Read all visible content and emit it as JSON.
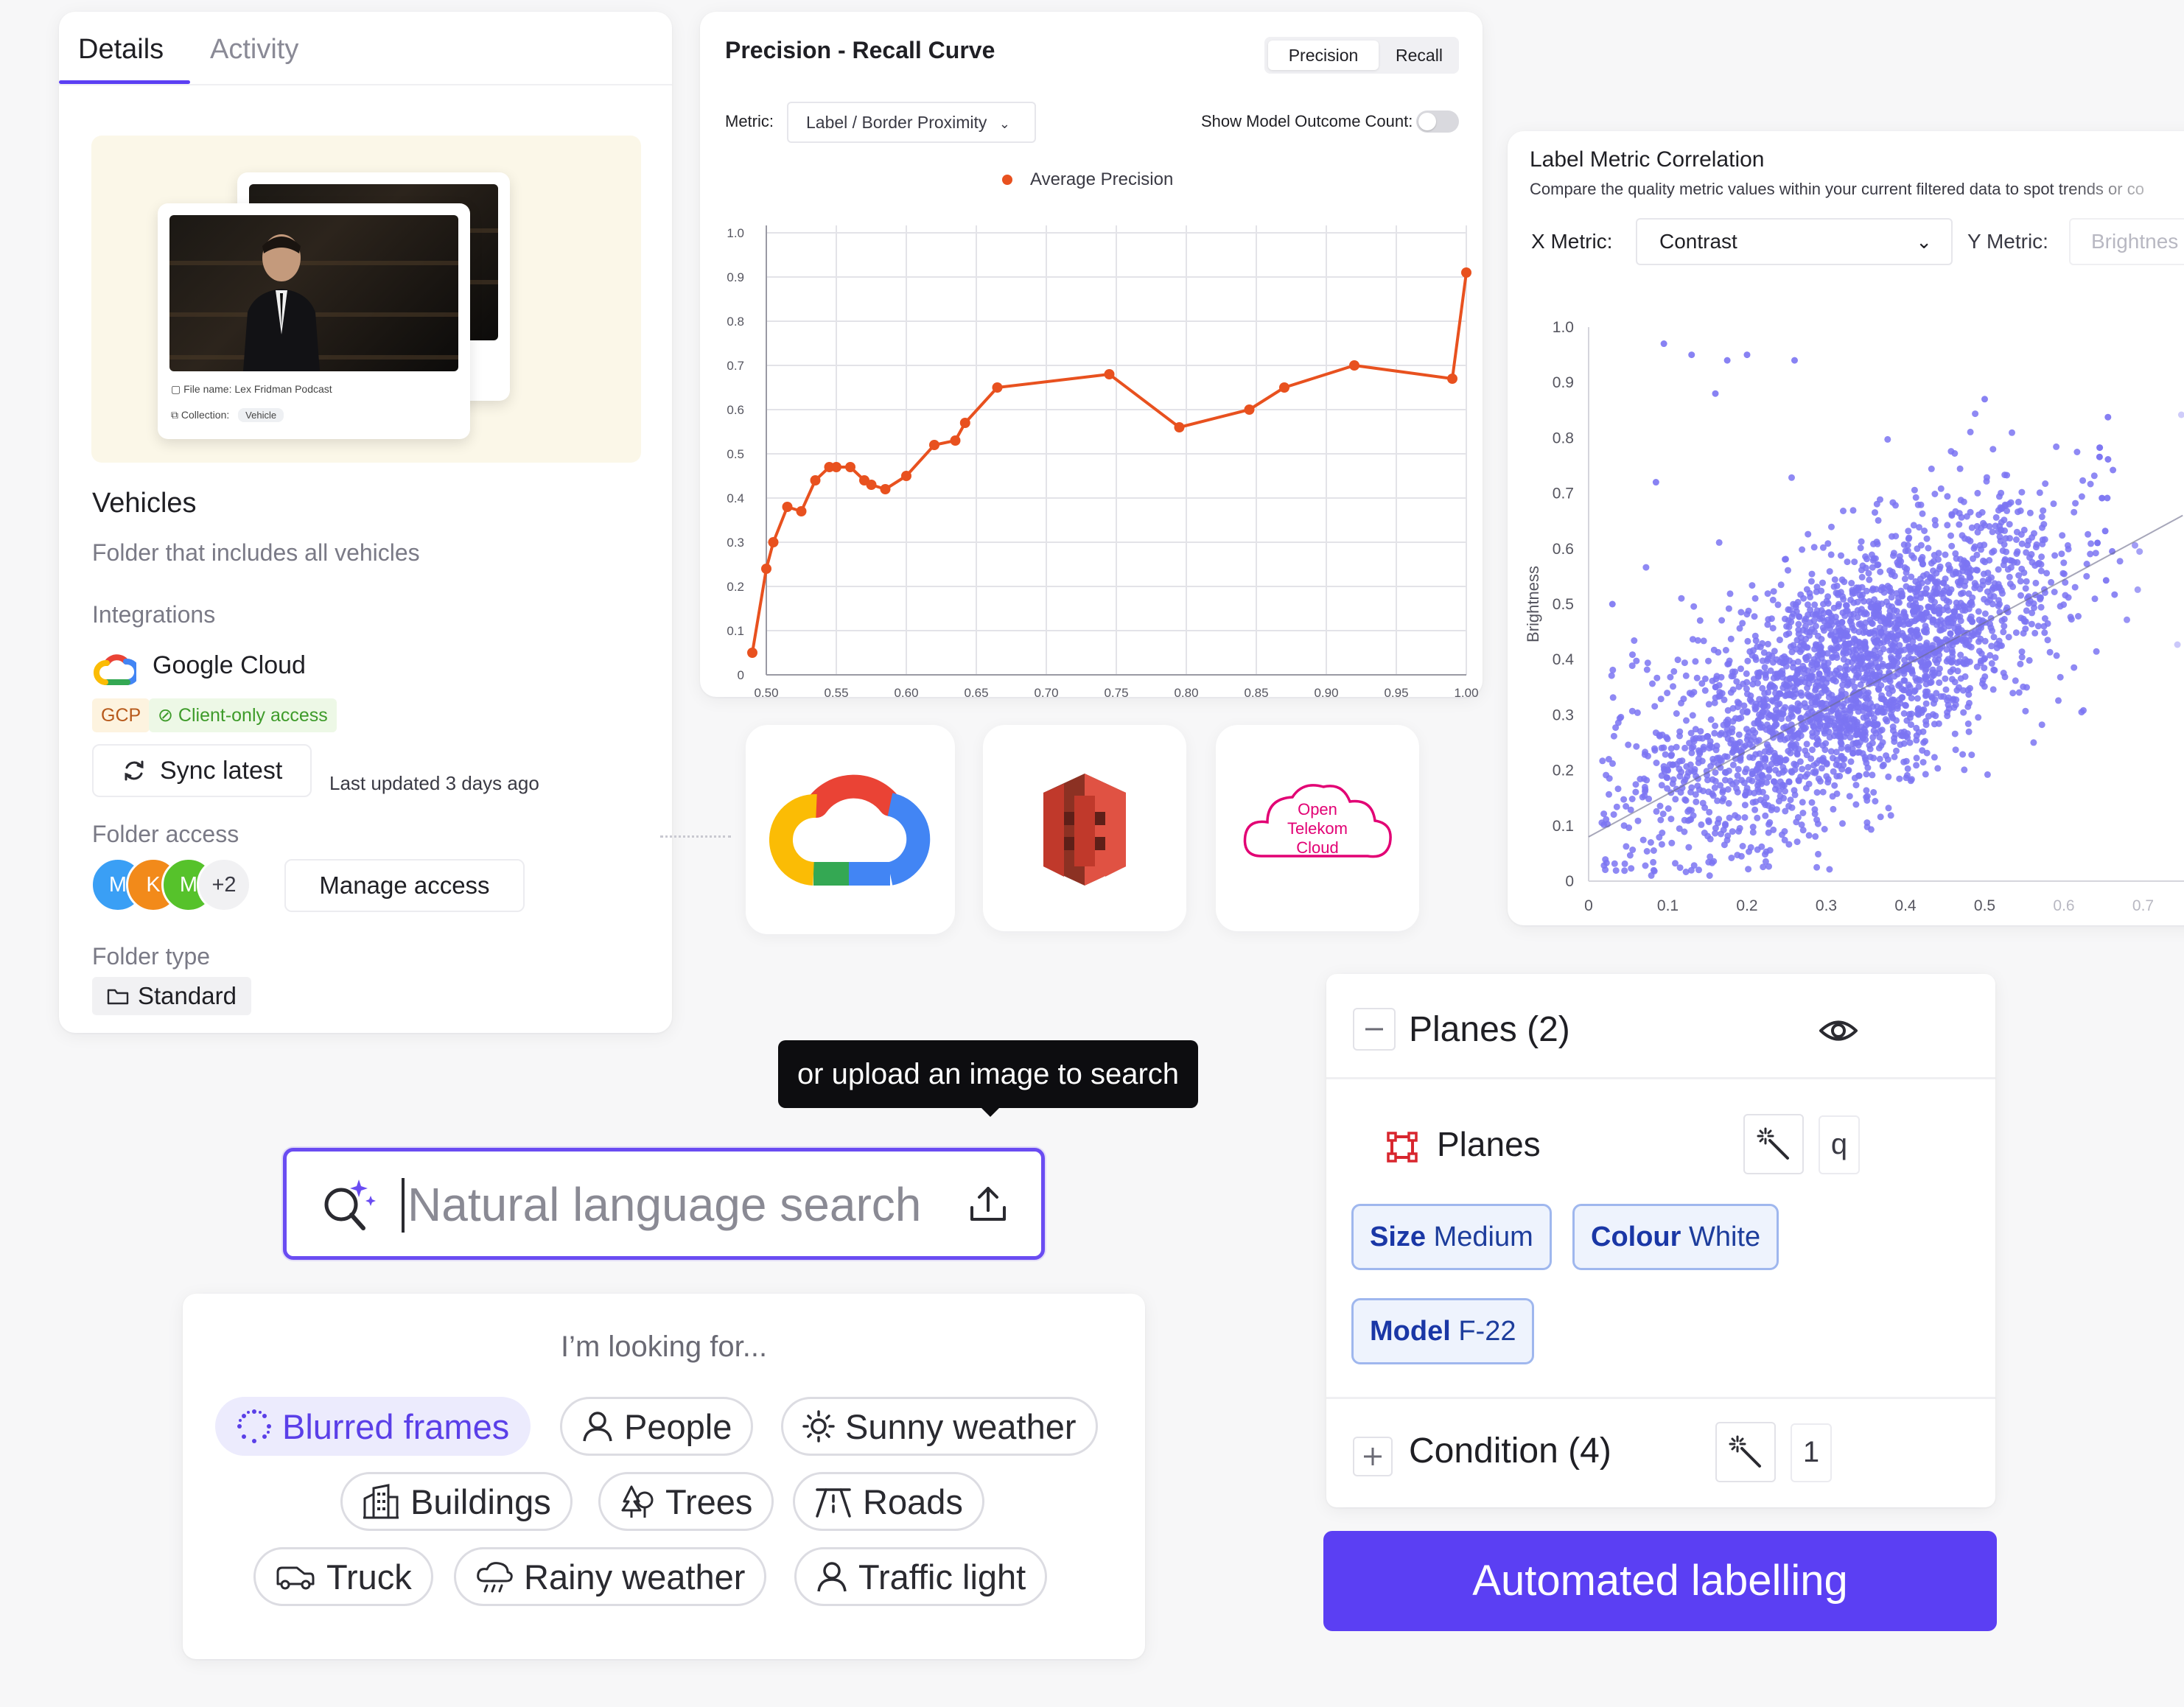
{
  "details": {
    "tabs": [
      "Details",
      "Activity"
    ],
    "preview": {
      "file_name_label": "File name:",
      "file_name": "Lex Fridman Podcast",
      "collection_label": "Collection:",
      "collection": "Vehicle"
    },
    "folder_title": "Vehicles",
    "folder_description": "Folder that includes all vehicles",
    "integrations_label": "Integrations",
    "integration_name": "Google Cloud",
    "badge_gcp": "GCP",
    "badge_access": "Client-only access",
    "sync_label": "Sync latest",
    "last_updated": "Last updated 3 days ago",
    "folder_access_label": "Folder access",
    "avatars": [
      "M",
      "K",
      "M",
      "+2"
    ],
    "avatar_colors": [
      "#3a9ff5",
      "#f28a1a",
      "#56c22b"
    ],
    "manage_access_label": "Manage access",
    "folder_type_label": "Folder type",
    "folder_type": "Standard",
    "accent": "#5b3ff3"
  },
  "pr_curve": {
    "title": "Precision - Recall Curve",
    "toggle": [
      "Precision",
      "Recall"
    ],
    "metric_label": "Metric:",
    "metric_value": "Label / Border Proximity",
    "outcome_label": "Show Model Outcome Count:",
    "outcome_toggle_on": false
  },
  "correlation": {
    "title": "Label Metric Correlation",
    "subtitle": "Compare the quality metric values within your current filtered data to spot trends or co",
    "x_metric_label": "X Metric:",
    "x_metric_value": "Contrast",
    "y_metric_label": "Y Metric:",
    "y_metric_value": "Brightnes"
  },
  "logos": [
    "google-cloud-logo",
    "aws-s3-logo",
    "open-telekom-cloud-logo"
  ],
  "otc_text": [
    "Open",
    "Telekom",
    "Cloud"
  ],
  "search": {
    "tooltip": "or upload an image to search",
    "placeholder": "Natural language search",
    "looking_for": "I’m looking for...",
    "pills": [
      "Blurred frames",
      "People",
      "Sunny weather",
      "Buildings",
      "Trees",
      "Roads",
      "Truck",
      "Rainy weather",
      "Traffic light"
    ]
  },
  "ontology": {
    "group_title": "Planes (2)",
    "class_name": "Planes",
    "class_hotkey": "q",
    "attributes": [
      {
        "key": "Size",
        "value": "Medium"
      },
      {
        "key": "Colour",
        "value": "White"
      },
      {
        "key": "Model",
        "value": "F-22"
      }
    ],
    "condition_title": "Condition (4)",
    "condition_hotkey": "1"
  },
  "auto_label_button": "Automated labelling",
  "chart_data": [
    {
      "type": "line",
      "title": "Precision - Recall Curve",
      "legend": [
        "Average Precision"
      ],
      "series_color": "#e8511f",
      "xlim": [
        0.5,
        1.0
      ],
      "ylim": [
        0,
        1.0
      ],
      "x_ticks": [
        "0.50",
        "0.55",
        "0.60",
        "0.65",
        "0.70",
        "0.75",
        "0.80",
        "0.85",
        "0.90",
        "0.95",
        "1.00"
      ],
      "y_ticks": [
        "0",
        "0.1",
        "0.2",
        "0.3",
        "0.4",
        "0.5",
        "0.6",
        "0.7",
        "0.8",
        "0.9",
        "1.0"
      ],
      "grid": true,
      "series": [
        {
          "name": "Average Precision",
          "x": [
            0.49,
            0.5,
            0.505,
            0.515,
            0.525,
            0.535,
            0.545,
            0.55,
            0.56,
            0.57,
            0.575,
            0.585,
            0.6,
            0.62,
            0.635,
            0.642,
            0.665,
            0.745,
            0.795,
            0.845,
            0.87,
            0.92,
            0.99,
            1.0
          ],
          "y": [
            0.05,
            0.24,
            0.3,
            0.38,
            0.37,
            0.44,
            0.47,
            0.47,
            0.47,
            0.44,
            0.43,
            0.42,
            0.45,
            0.52,
            0.53,
            0.57,
            0.65,
            0.68,
            0.56,
            0.6,
            0.65,
            0.7,
            0.67,
            0.91
          ]
        }
      ]
    },
    {
      "type": "scatter",
      "title": "Label Metric Correlation",
      "xlabel": "Contrast",
      "ylabel": "Brightness",
      "xlim": [
        0,
        0.75
      ],
      "ylim": [
        0,
        1.0
      ],
      "x_ticks": [
        "0",
        "0.1",
        "0.2",
        "0.3",
        "0.4",
        "0.5",
        "0.6",
        "0.7"
      ],
      "y_ticks": [
        "0",
        "0.1",
        "0.2",
        "0.3",
        "0.4",
        "0.5",
        "0.6",
        "0.7",
        "0.8",
        "0.9",
        "1.0"
      ],
      "point_color": "#7b74f2",
      "trendline": {
        "x": [
          0,
          0.75
        ],
        "y": [
          0.08,
          0.66
        ]
      },
      "outliers": [
        {
          "x": 0.095,
          "y": 0.97
        },
        {
          "x": 0.13,
          "y": 0.95
        },
        {
          "x": 0.175,
          "y": 0.94
        },
        {
          "x": 0.2,
          "y": 0.95
        },
        {
          "x": 0.26,
          "y": 0.94
        },
        {
          "x": 0.03,
          "y": 0.5
        },
        {
          "x": 0.085,
          "y": 0.72
        },
        {
          "x": 0.5,
          "y": 0.87
        },
        {
          "x": 0.16,
          "y": 0.88
        }
      ],
      "cloud": {
        "n": 2600,
        "x_mean": 0.33,
        "x_sd": 0.13,
        "slope": 0.75,
        "intercept": 0.12,
        "y_sd": 0.11
      }
    }
  ]
}
